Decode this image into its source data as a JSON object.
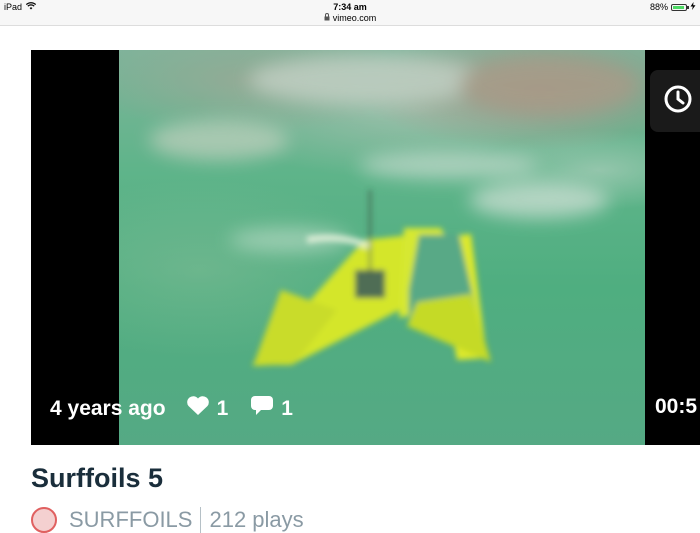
{
  "status_bar": {
    "device": "iPad",
    "time": "7:34 am",
    "url": "vimeo.com",
    "battery": "88%",
    "battery_level": 0.88
  },
  "video": {
    "posted": "4 years ago",
    "likes": "1",
    "comments": "1",
    "duration": "00:5"
  },
  "title": "Surffoils 5",
  "byline": {
    "user": "SURFFOILS",
    "plays": "212 plays"
  },
  "icons": {
    "wifi": "wifi-icon",
    "lock": "lock-icon",
    "battery": "battery-icon",
    "charging": "bolt-icon",
    "watch_later": "clock-icon",
    "like": "heart-icon",
    "comment": "speech-bubble-icon"
  },
  "colors": {
    "title": "#1a2e3b",
    "muted": "#8a9aa4",
    "battery_fill": "#4cd964"
  }
}
